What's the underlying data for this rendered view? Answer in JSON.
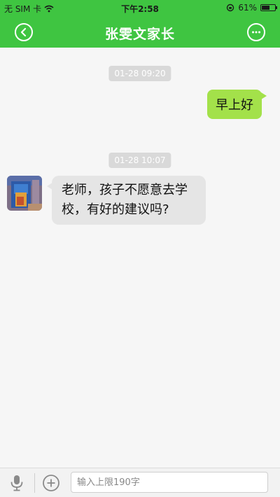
{
  "status_bar": {
    "carrier": "无 SIM 卡",
    "time": "下午2:58",
    "battery": "61%",
    "battery_level": 0.61
  },
  "nav": {
    "title": "张雯文家长",
    "back_icon": "chevron-left-circle-icon",
    "more_icon": "more-circle-icon"
  },
  "messages": [
    {
      "type": "timestamp",
      "text": "01-28 09:20"
    },
    {
      "type": "outgoing",
      "text": "早上好"
    },
    {
      "type": "timestamp",
      "text": "01-28 10:07"
    },
    {
      "type": "incoming",
      "text": "老师，孩子不愿意去学校，有好的建议吗?"
    }
  ],
  "input_bar": {
    "placeholder": "输入上限190字",
    "value": "",
    "mic_icon": "microphone-icon",
    "add_icon": "plus-circle-icon"
  },
  "colors": {
    "header": "#3fc541",
    "outgoing_bubble": "#a3e14a",
    "incoming_bubble": "#e5e5e5",
    "timestamp_bg": "#d9d9d9"
  }
}
